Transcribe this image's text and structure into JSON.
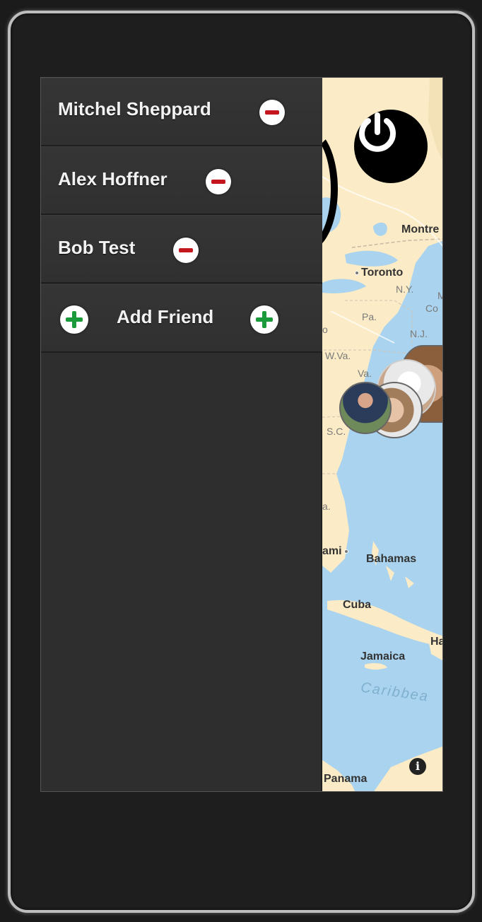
{
  "friends": [
    {
      "name": "Mitchel Sheppard",
      "action_icon": "minus-circle-icon"
    },
    {
      "name": "Alex Hoffner",
      "action_icon": "minus-circle-icon"
    },
    {
      "name": "Bob Test",
      "action_icon": "minus-circle-icon"
    }
  ],
  "add_friend": {
    "label": "Add Friend",
    "icon": "plus-circle-icon"
  },
  "map": {
    "labels": {
      "montreal": "Montre",
      "toronto": "Toronto",
      "ny": "N.Y.",
      "pa": "Pa.",
      "nj": "N.J.",
      "co": "Co",
      "m": "M",
      "o": "o",
      "wva": "W.Va.",
      "va": "Va.",
      "sc": "S.C.",
      "fla": "a.",
      "miami": "ami",
      "bahamas": "Bahamas",
      "cuba": "Cuba",
      "ha": "Ha",
      "jamaica": "Jamaica",
      "caribbean": "Caribbea",
      "panama": "Panama"
    },
    "info_glyph": "i"
  },
  "colors": {
    "drawer_bg": "#2e2e2e",
    "remove_red": "#c4161c",
    "add_green": "#1a9a3a",
    "water": "#a9d3ee",
    "land": "#fbebc6"
  }
}
